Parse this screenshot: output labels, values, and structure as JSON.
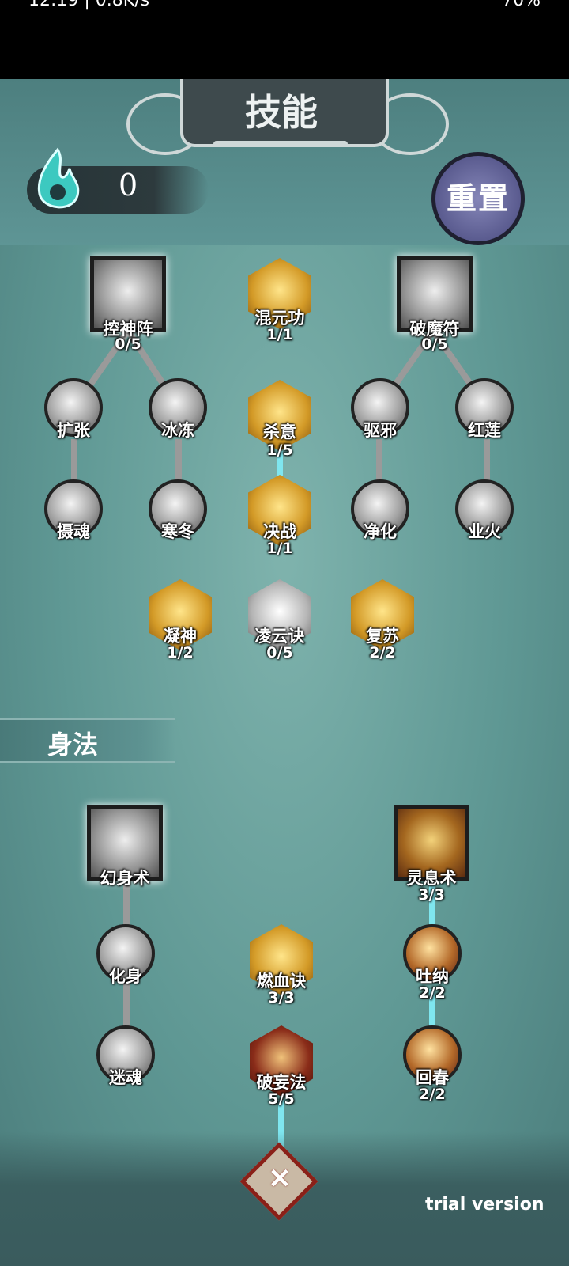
{
  "status_bar": {
    "time": "12:19 | 0.8K/s",
    "battery": "70%"
  },
  "header": {
    "title": "技能",
    "reset_label": "重置"
  },
  "points": {
    "value": "0"
  },
  "skill_tree": [
    {
      "name": "控神阵",
      "level": "0/5",
      "shape": "square",
      "tint": "silver"
    },
    {
      "name": "混元功",
      "level": "1/1",
      "shape": "hex",
      "tint": "gold"
    },
    {
      "name": "破魔符",
      "level": "0/5",
      "shape": "square",
      "tint": "silver"
    },
    {
      "name": "扩张",
      "level": "",
      "shape": "circle",
      "tint": "silver"
    },
    {
      "name": "冰冻",
      "level": "",
      "shape": "circle",
      "tint": "silver"
    },
    {
      "name": "杀意",
      "level": "1/5",
      "shape": "hex",
      "tint": "gold"
    },
    {
      "name": "驱邪",
      "level": "",
      "shape": "circle",
      "tint": "silver"
    },
    {
      "name": "红莲",
      "level": "",
      "shape": "circle",
      "tint": "silver"
    },
    {
      "name": "摄魂",
      "level": "",
      "shape": "circle",
      "tint": "silver"
    },
    {
      "name": "寒冬",
      "level": "",
      "shape": "circle",
      "tint": "silver"
    },
    {
      "name": "决战",
      "level": "1/1",
      "shape": "hex",
      "tint": "gold"
    },
    {
      "name": "净化",
      "level": "",
      "shape": "circle",
      "tint": "silver"
    },
    {
      "name": "业火",
      "level": "",
      "shape": "circle",
      "tint": "silver"
    },
    {
      "name": "凝神",
      "level": "1/2",
      "shape": "hex",
      "tint": "gold"
    },
    {
      "name": "凌云诀",
      "level": "0/5",
      "shape": "hex",
      "tint": "silver"
    },
    {
      "name": "复苏",
      "level": "2/2",
      "shape": "hex",
      "tint": "gold"
    }
  ],
  "movement_section": {
    "title": "身法"
  },
  "movement_tree": [
    {
      "name": "幻身术",
      "level": "",
      "shape": "square",
      "tint": "silver"
    },
    {
      "name": "灵息术",
      "level": "3/3",
      "shape": "square",
      "tint": "gold"
    },
    {
      "name": "化身",
      "level": "",
      "shape": "circle",
      "tint": "silver"
    },
    {
      "name": "燃血诀",
      "level": "3/3",
      "shape": "hex",
      "tint": "gold"
    },
    {
      "name": "吐纳",
      "level": "2/2",
      "shape": "circle",
      "tint": "gold"
    },
    {
      "name": "迷魂",
      "level": "",
      "shape": "circle",
      "tint": "silver"
    },
    {
      "name": "破妄法",
      "level": "5/5",
      "shape": "hex",
      "tint": "red"
    },
    {
      "name": "回春",
      "level": "2/2",
      "shape": "circle",
      "tint": "gold"
    }
  ],
  "watermark": "trial version"
}
